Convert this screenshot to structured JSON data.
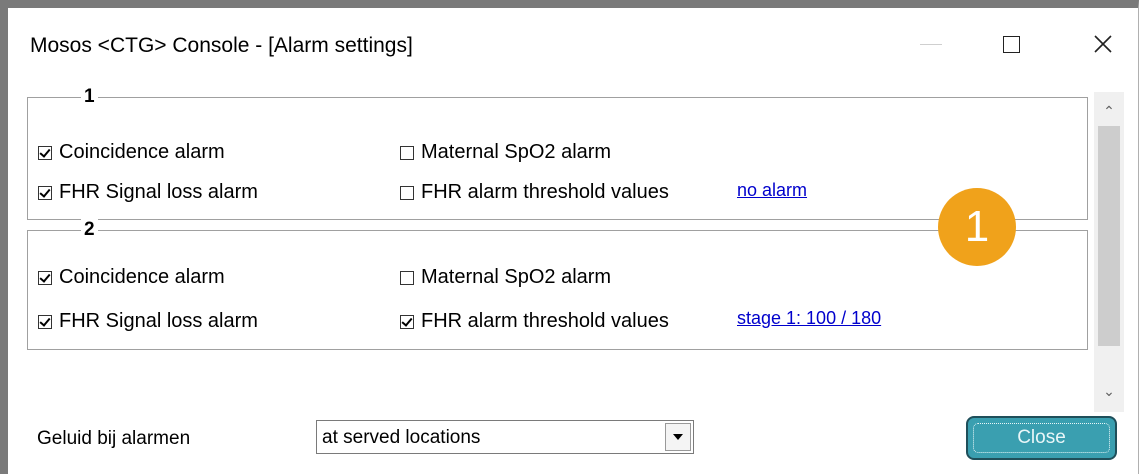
{
  "window": {
    "title": "Mosos <CTG> Console - [Alarm settings]"
  },
  "groups": [
    {
      "number": "1",
      "coincidence": {
        "label": "Coincidence alarm",
        "checked": true
      },
      "signal_loss": {
        "label": "FHR Signal loss alarm",
        "checked": true
      },
      "spo2": {
        "label": "Maternal SpO2 alarm",
        "checked": false
      },
      "threshold": {
        "label": "FHR alarm threshold values",
        "checked": false
      },
      "threshold_link": "no alarm"
    },
    {
      "number": "2",
      "coincidence": {
        "label": "Coincidence alarm",
        "checked": true
      },
      "signal_loss": {
        "label": "FHR Signal loss alarm",
        "checked": true
      },
      "spo2": {
        "label": "Maternal SpO2 alarm",
        "checked": false
      },
      "threshold": {
        "label": "FHR alarm threshold values",
        "checked": true
      },
      "threshold_link": "stage 1: 100 / 180"
    }
  ],
  "callout_badge": "1",
  "sound": {
    "label": "Geluid bij alarmen",
    "selected": "at served locations"
  },
  "buttons": {
    "close": "Close"
  },
  "colors": {
    "accent_button": "#3a9fb0",
    "badge": "#f0a21b",
    "link": "#0000cc"
  }
}
